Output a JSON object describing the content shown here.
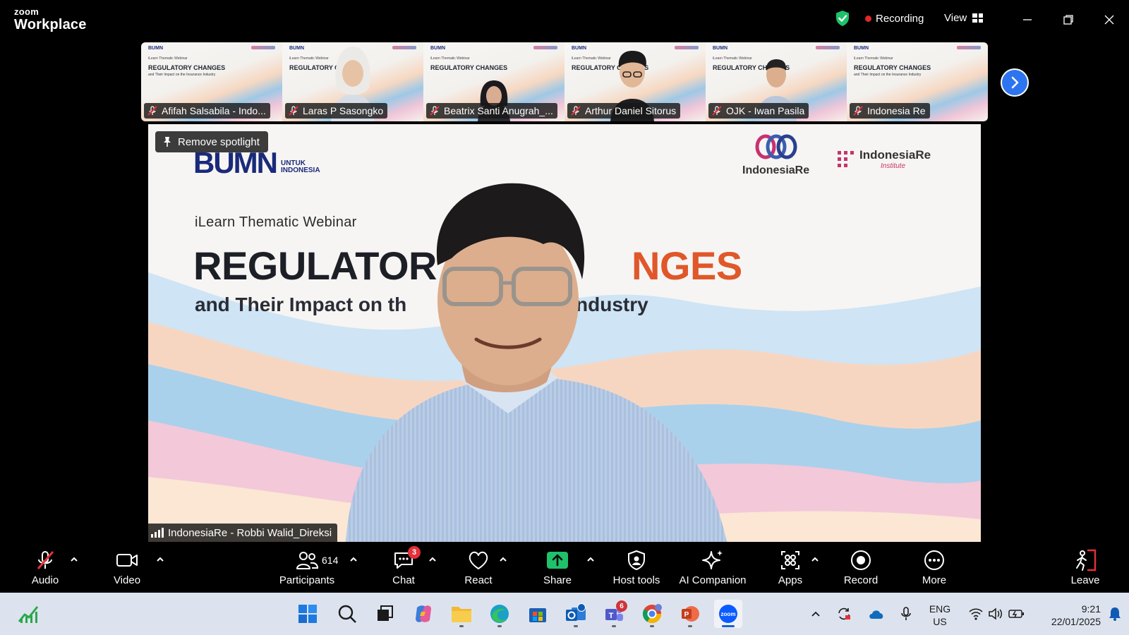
{
  "app": {
    "brand_top": "zoom",
    "brand_bottom": "Workplace"
  },
  "header": {
    "recording_label": "Recording",
    "view_label": "View"
  },
  "thumbnails": [
    {
      "name": "Afifah Salsabila - Indo...",
      "has_person": false
    },
    {
      "name": "Laras P Sasongko",
      "has_person": true
    },
    {
      "name": "Beatrix Santi Anugrah_...",
      "has_person": true
    },
    {
      "name": "Arthur Daniel Sitorus",
      "has_person": true
    },
    {
      "name": "OJK - Iwan Pasila",
      "has_person": true
    },
    {
      "name": "Indonesia Re",
      "has_person": false
    }
  ],
  "thumb_slide": {
    "bumn": "BUMN",
    "sub": "iLearn Thematic Webinar",
    "title_a": "REGULATORY CH",
    "title_b": "ANGES",
    "title_full": "REGULATORY CHANGES",
    "sub2": "and Their Impact on the Insurance Industry"
  },
  "main": {
    "spotlight_label": "Remove spotlight",
    "bumn_big": "BUMN",
    "bumn_small_1": "UNTUK",
    "bumn_small_2": "INDONESIA",
    "ir_logo": "IndonesiaRe",
    "iri_logo": "IndonesiaRe",
    "iri_sub": "Institute",
    "webinar": "iLearn Thematic Webinar",
    "headline_a": "REGULATOR",
    "headline_b": "NGES",
    "subline_a": "and Their Impact on th",
    "subline_b": "Industry",
    "speaker_name": "IndonesiaRe - Robbi Walid_Direksi"
  },
  "toolbar": {
    "audio": "Audio",
    "video": "Video",
    "participants": "Participants",
    "participants_count": "614",
    "chat": "Chat",
    "chat_badge": "3",
    "react": "React",
    "share": "Share",
    "host_tools": "Host tools",
    "ai_companion": "AI Companion",
    "apps": "Apps",
    "record": "Record",
    "more": "More",
    "leave": "Leave"
  },
  "taskbar": {
    "teams_badge": "6",
    "lang_1": "ENG",
    "lang_2": "US",
    "time": "9:21",
    "date": "22/01/2025"
  },
  "colors": {
    "accent": "#2d74f0",
    "record_red": "#e02828",
    "share_green": "#1fc16b",
    "headline_orange": "#e0572a"
  }
}
